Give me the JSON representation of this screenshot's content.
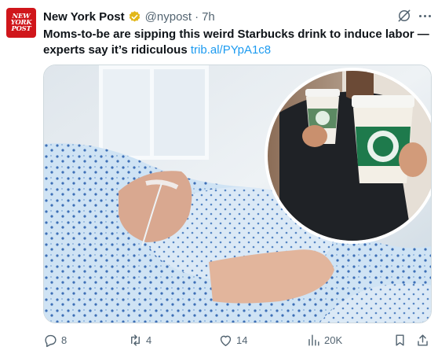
{
  "post": {
    "avatar_text": "NEW\nYORK\nPOST",
    "author_name": "New York Post",
    "handle": "@nypost",
    "separator": "·",
    "timestamp": "7h",
    "text": "Moms-to-be are sipping this weird Starbucks drink to induce labor — experts say it’s ridiculous",
    "link": "trib.al/PYpA1c8"
  },
  "actions": {
    "replies": "8",
    "reposts": "4",
    "likes": "14",
    "views": "20K"
  },
  "colors": {
    "brand_red": "#d0161b",
    "link_blue": "#1d9bf0",
    "verified_gold": "#e2b719",
    "secondary_text": "#536471",
    "starbucks_green": "#1e7a4c"
  },
  "icons": [
    "verified-badge-icon",
    "grok-icon",
    "more-icon",
    "reply-icon",
    "repost-icon",
    "like-icon",
    "views-icon",
    "bookmark-icon",
    "share-icon"
  ]
}
